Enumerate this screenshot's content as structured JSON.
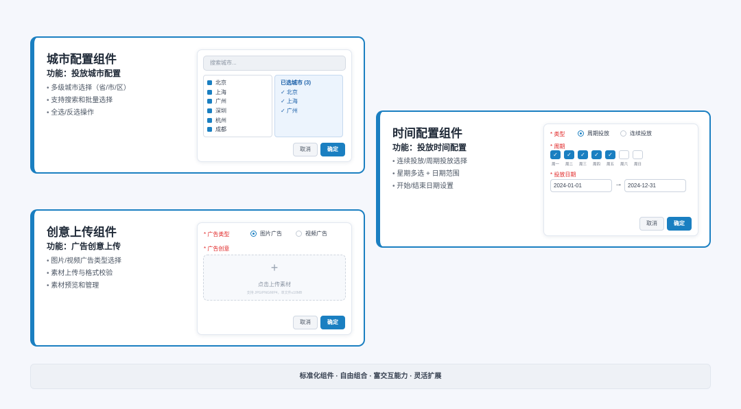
{
  "city_card": {
    "title": "城市配置组件",
    "subtitle": "功能：投放城市配置",
    "bullets": [
      "多级城市选择（省/市/区）",
      "支持搜索和批量选择",
      "全选/反选操作"
    ],
    "search_placeholder": "搜索城市...",
    "cities": [
      "北京",
      "上海",
      "广州",
      "深圳",
      "杭州",
      "成都"
    ],
    "selected_header": "已选城市 (3)",
    "selected": [
      "✓ 北京",
      "✓ 上海",
      "✓ 广州"
    ],
    "cancel": "取消",
    "confirm": "确定"
  },
  "creative_card": {
    "title": "创意上传组件",
    "subtitle": "功能：广告创意上传",
    "bullets": [
      "图片/视频广告类型选择",
      "素材上传与格式校验",
      "素材预览和管理"
    ],
    "type_label": "* 广告类型",
    "type_options": [
      "图片广告",
      "视频广告"
    ],
    "selected_type": "图片广告",
    "creative_label": "* 广告创意",
    "upload_plus": "+",
    "upload_text": "点击上传素材",
    "upload_hint": "支持 JPG/PNG/MP4，单文件≤10MB",
    "cancel": "取消",
    "confirm": "确定"
  },
  "time_card": {
    "title": "时间配置组件",
    "subtitle": "功能：投放时间配置",
    "bullets": [
      "连续投放/周期投放选择",
      "星期多选 + 日期范围",
      "开始/结束日期设置"
    ],
    "type_label": "* 类型",
    "type_options": [
      "周期投放",
      "连续投放"
    ],
    "selected_type": "周期投放",
    "period_label": "* 周期",
    "days": [
      {
        "label": "周一",
        "checked": true
      },
      {
        "label": "周二",
        "checked": true
      },
      {
        "label": "周三",
        "checked": true
      },
      {
        "label": "周四",
        "checked": true
      },
      {
        "label": "周五",
        "checked": true
      },
      {
        "label": "周六",
        "checked": false
      },
      {
        "label": "周日",
        "checked": false
      }
    ],
    "check_mark": "✓",
    "date_label": "* 投放日期",
    "start_date": "2024-01-01",
    "arrow": "→",
    "end_date": "2024-12-31",
    "cancel": "取消",
    "confirm": "确定"
  },
  "footer": "标准化组件 · 自由组合 · 富交互能力 · 灵活扩展",
  "colors": {
    "accent": "#1a7fc1",
    "required": "#e02424",
    "background": "#f5f7fc"
  }
}
